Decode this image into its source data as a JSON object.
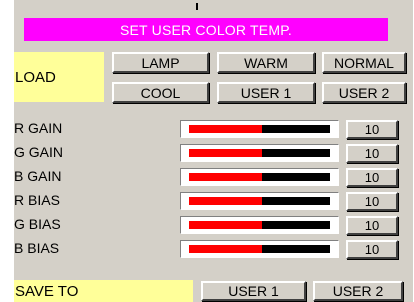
{
  "title": "SET USER COLOR TEMP.",
  "load": {
    "label": "LOAD",
    "buttons": [
      "LAMP",
      "WARM",
      "NORMAL",
      "COOL",
      "USER 1",
      "USER 2"
    ]
  },
  "rows": [
    {
      "label": "R GAIN",
      "value": "10",
      "level": 0.52
    },
    {
      "label": "G GAIN",
      "value": "10",
      "level": 0.52
    },
    {
      "label": "B GAIN",
      "value": "10",
      "level": 0.52
    },
    {
      "label": "R BIAS",
      "value": "10",
      "level": 0.52
    },
    {
      "label": "G BIAS",
      "value": "10",
      "level": 0.52
    },
    {
      "label": "B BIAS",
      "value": "10",
      "level": 0.52
    }
  ],
  "save": {
    "label": "SAVE TO",
    "buttons": [
      "USER 1",
      "USER 2"
    ]
  },
  "colors": {
    "title_bg": "#ff00ff",
    "label_bg": "#ffff99",
    "bar_fill": "#ff0000",
    "bar_track": "#000000"
  }
}
